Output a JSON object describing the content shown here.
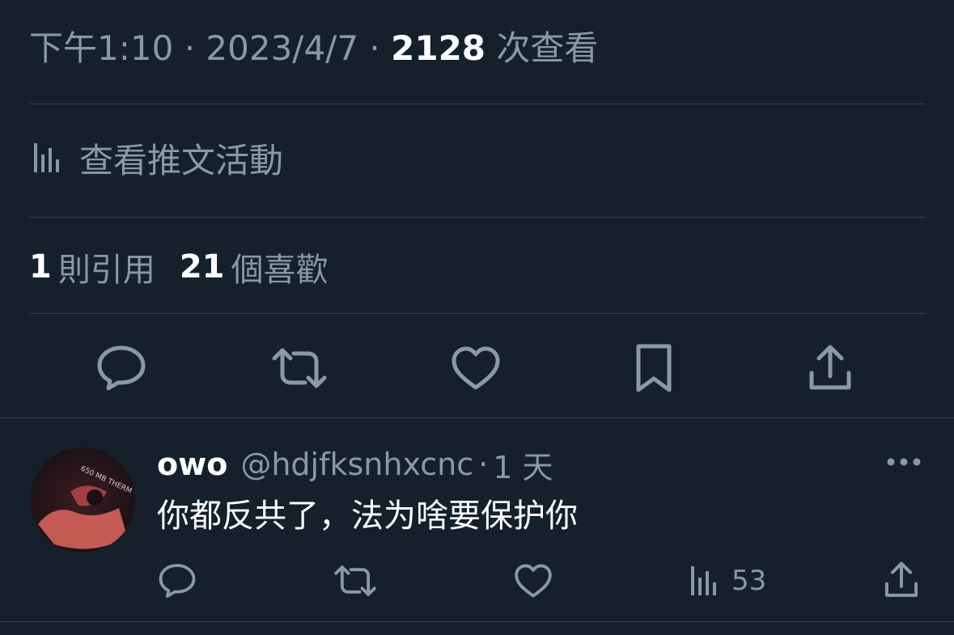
{
  "tweet": {
    "time": "下午1:10",
    "dot": "·",
    "date": "2023/4/7",
    "views": "2128",
    "views_label": "次查看",
    "activity_label": "查看推文活動",
    "quotes_count": "1",
    "quotes_label": "則引用",
    "likes_count": "21",
    "likes_label": "個喜歡"
  },
  "actions": {
    "reply_icon": "speech-bubble-icon",
    "retweet_icon": "retweet-icon",
    "like_icon": "heart-icon",
    "bookmark_icon": "bookmark-icon",
    "share_icon": "share-icon"
  },
  "reply": {
    "display_name": "owo",
    "handle": "@hdjfksnhxcnc",
    "dot": "·",
    "age": "1 天",
    "text": "你都反共了，法为啥要保护你",
    "views": "53",
    "avatar_text": "650 MB THERM"
  },
  "colors": {
    "background": "#15202b",
    "muted": "#8b98a5",
    "primary_text": "#ffffff",
    "divider": "#38444d"
  }
}
